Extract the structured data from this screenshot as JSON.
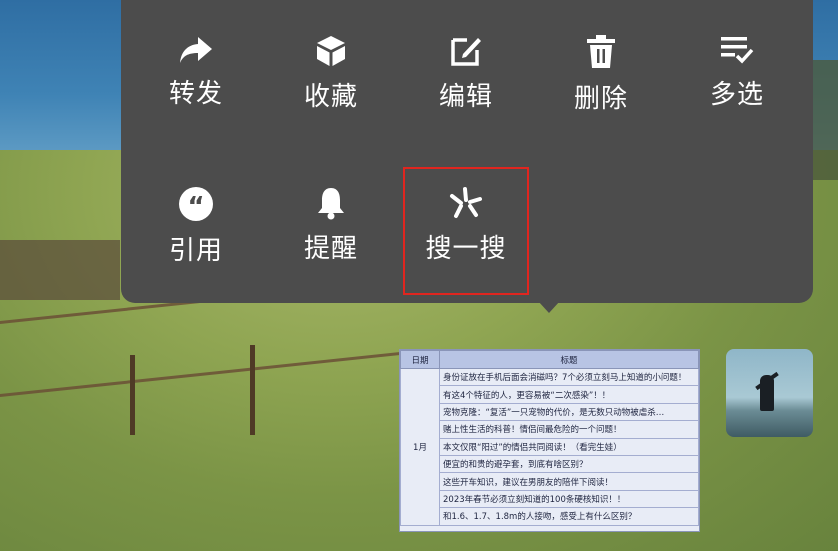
{
  "menu": {
    "row1": [
      {
        "label": "转发",
        "icon": "share-arrow-icon"
      },
      {
        "label": "收藏",
        "icon": "cube-icon"
      },
      {
        "label": "编辑",
        "icon": "edit-icon"
      },
      {
        "label": "删除",
        "icon": "trash-icon"
      },
      {
        "label": "多选",
        "icon": "multi-select-icon"
      }
    ],
    "row2": [
      {
        "label": "引用",
        "icon": "quote-icon"
      },
      {
        "label": "提醒",
        "icon": "bell-icon"
      },
      {
        "label": "搜一搜",
        "icon": "search-spark-icon"
      }
    ],
    "highlighted": "搜一搜",
    "highlight_color": "#e0251f",
    "background": "#4c4c4c"
  },
  "table": {
    "headers": [
      "日期",
      "标题"
    ],
    "date_cell": "1月",
    "rows": [
      "身份证放在手机后面会消磁吗？7个必须立刻马上知道的小问题！",
      "有这4个特征的人，更容易被“二次感染”！！",
      "宠物克隆：“复活”一只宠物的代价，是无数只动物被虐杀…",
      "赌上性生活的科普！情侣间最危险的一个问题！",
      "本文仅限“阳过”的情侣共同阅读！（看完生娃）",
      "便宜的和贵的避孕套，到底有啥区别？",
      "这些开车知识，建议在男朋友的陪伴下阅读！",
      "2023年春节必须立刻知道的100条硬核知识！！",
      "和1.6、1.7、1.8m的人接吻，感受上有什么区别？"
    ]
  },
  "thumbnail": {
    "icon": "person-photo-thumbnail"
  }
}
